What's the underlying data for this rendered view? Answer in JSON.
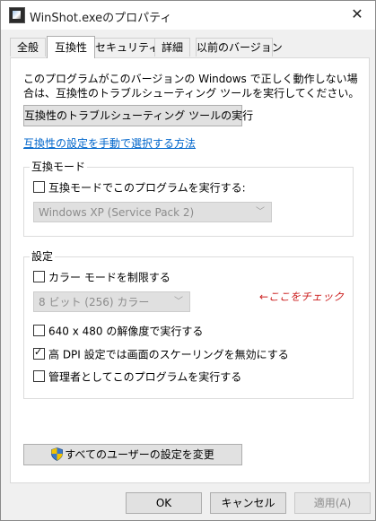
{
  "window": {
    "title": "WinShot.exeのプロパティ",
    "close_glyph": "✕"
  },
  "tabs": [
    {
      "label": "全般",
      "active": false
    },
    {
      "label": "互換性",
      "active": true
    },
    {
      "label": "セキュリティ",
      "active": false
    },
    {
      "label": "詳細",
      "active": false
    },
    {
      "label": "以前のバージョン",
      "active": false
    }
  ],
  "intro_text": "このプログラムがこのバージョンの Windows で正しく動作しない場合は、互換性のトラブルシューティング ツールを実行してください。",
  "troubleshooter_button": "互換性のトラブルシューティング ツールの実行",
  "manual_link": "互換性の設定を手動で選択する方法",
  "compat_mode": {
    "group_title": "互換モード",
    "checkbox_label": "互換モードでこのプログラムを実行する:",
    "checked": false,
    "select_value": "Windows XP (Service Pack 2)"
  },
  "settings": {
    "group_title": "設定",
    "color_mode": {
      "label": "カラー モードを制限する",
      "checked": false
    },
    "color_select_value": "8 ビット (256) カラー",
    "resolution": {
      "label": "640 x 480 の解像度で実行する",
      "checked": false
    },
    "dpi_scaling": {
      "label": "高 DPI 設定では画面のスケーリングを無効にする",
      "checked": true
    },
    "admin": {
      "label": "管理者としてこのプログラムを実行する",
      "checked": false
    }
  },
  "annotation": "←ここをチェック",
  "all_users_button": "すべてのユーザーの設定を変更",
  "footer": {
    "ok": "OK",
    "cancel": "キャンセル",
    "apply": "適用(A)"
  },
  "colors": {
    "link": "#0066cc",
    "annotation": "#cc2020",
    "disabled_text": "#8c8c8c"
  }
}
